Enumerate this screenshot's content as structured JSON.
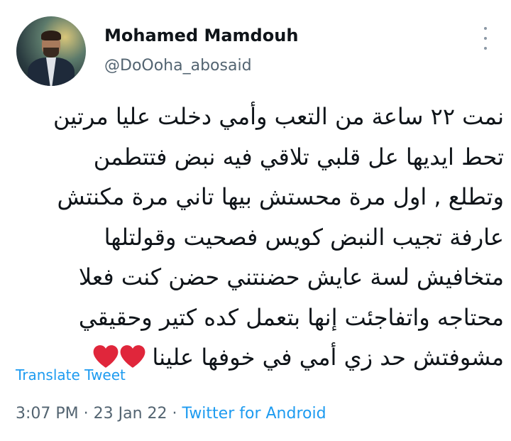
{
  "user": {
    "display_name": "Mohamed Mamdouh",
    "handle": "@DoOoha_abosaid"
  },
  "tweet": {
    "lines": [
      "نمت ٢٢ ساعة من التعب وأمي دخلت عليا مرتين",
      "تحط ايديها عل قلبي تلاقي فيه نبض فتتطمن",
      "وتطلع , اول مرة محستش بيها تاني مرة مكنتش",
      "عارفة تجيب النبض كويس فصحيت وقولتلها",
      "متخافيش لسة عايش حضنتني حضن كنت فعلا",
      "محتاجه واتفاجئت إنها بتعمل كده كتير وحقيقي",
      "مشوفتش حد زي أمي في خوفها علينا"
    ],
    "emoji": "❤️❤️"
  },
  "actions": {
    "translate_label": "Translate Tweet"
  },
  "meta": {
    "time": "3:07 PM",
    "sep1": " · ",
    "date": "23 Jan 22",
    "sep2": " · ",
    "source": "Twitter for Android"
  },
  "icons": {
    "more": "more-vertical-icon",
    "heart": "red-heart-icon"
  },
  "colors": {
    "link": "#1d9bf0",
    "secondary_text": "#536471",
    "heart": "#e0263b"
  }
}
